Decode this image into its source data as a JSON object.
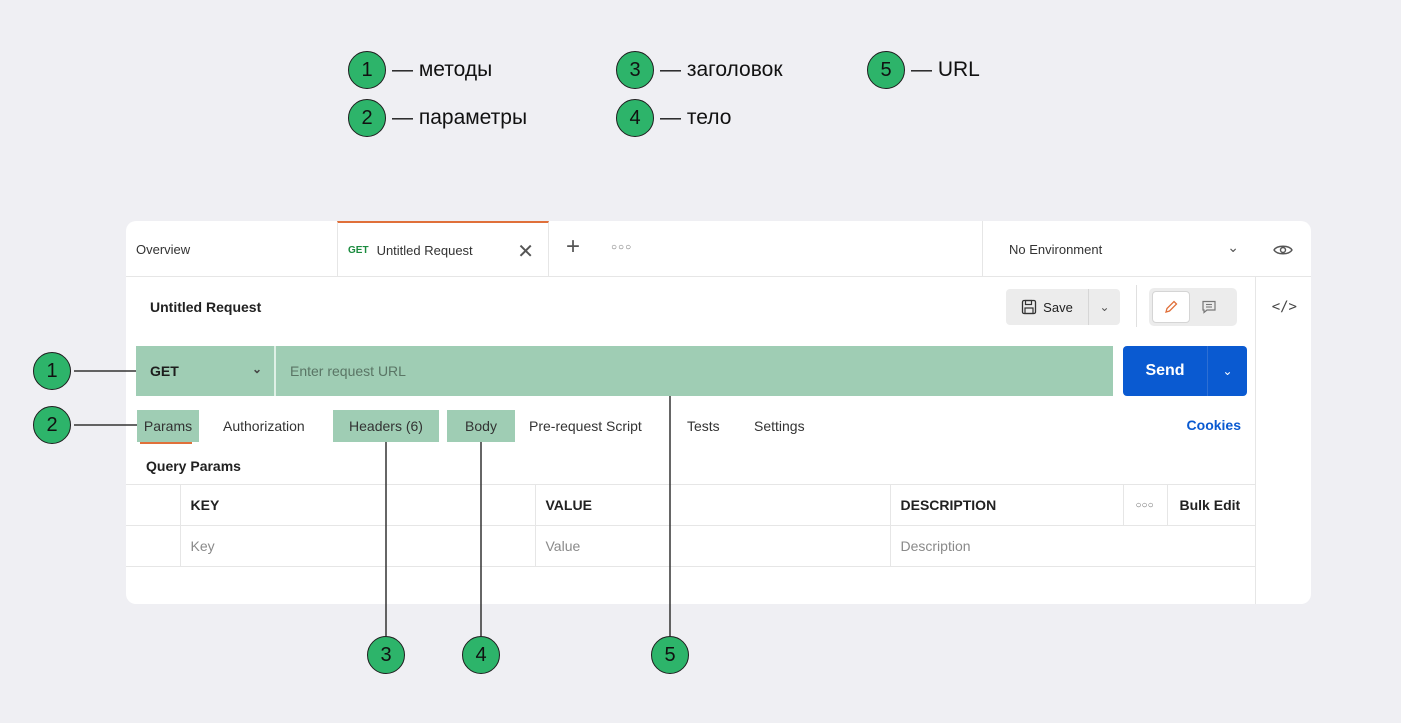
{
  "legend": [
    {
      "num": "1",
      "text": "— методы"
    },
    {
      "num": "2",
      "text": "— параметры"
    },
    {
      "num": "3",
      "text": "— заголовок"
    },
    {
      "num": "4",
      "text": "— тело"
    },
    {
      "num": "5",
      "text": "— URL"
    }
  ],
  "tabs": {
    "overview": "Overview",
    "active_method": "GET",
    "active_title": "Untitled Request",
    "environment": "No Environment"
  },
  "request": {
    "title": "Untitled Request",
    "save_label": "Save",
    "method": "GET",
    "url_value": "",
    "url_placeholder": "Enter request URL",
    "send_label": "Send"
  },
  "subtabs": {
    "params": "Params",
    "authorization": "Authorization",
    "headers": "Headers (6)",
    "body": "Body",
    "prerequest": "Pre-request Script",
    "tests": "Tests",
    "settings": "Settings",
    "cookies": "Cookies"
  },
  "query_params": {
    "title": "Query Params",
    "columns": [
      "KEY",
      "VALUE",
      "DESCRIPTION",
      "Bulk Edit"
    ],
    "row_placeholders": [
      "Key",
      "Value",
      "Description"
    ]
  },
  "annotations": {
    "methods": "1",
    "params": "2",
    "headers": "3",
    "body": "4",
    "url": "5"
  },
  "colors": {
    "highlight": "#9fcdb4",
    "badge": "#2db46a",
    "accent": "#e0703a",
    "send": "#0a5ad1"
  }
}
